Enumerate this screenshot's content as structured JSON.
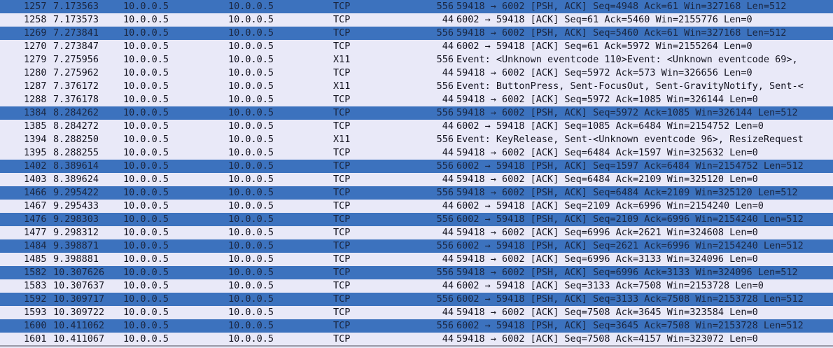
{
  "packets": [
    {
      "no": "1257",
      "time": "7.173563",
      "src": "10.0.0.5",
      "dst": "10.0.0.5",
      "proto": "TCP",
      "len": "556",
      "info": "59418 → 6002 [PSH, ACK] Seq=4948 Ack=61 Win=327168 Len=512",
      "selected": true
    },
    {
      "no": "1258",
      "time": "7.173573",
      "src": "10.0.0.5",
      "dst": "10.0.0.5",
      "proto": "TCP",
      "len": "44",
      "info": "6002 → 59418 [ACK] Seq=61 Ack=5460 Win=2155776 Len=0",
      "selected": false
    },
    {
      "no": "1269",
      "time": "7.273841",
      "src": "10.0.0.5",
      "dst": "10.0.0.5",
      "proto": "TCP",
      "len": "556",
      "info": "59418 → 6002 [PSH, ACK] Seq=5460 Ack=61 Win=327168 Len=512",
      "selected": true
    },
    {
      "no": "1270",
      "time": "7.273847",
      "src": "10.0.0.5",
      "dst": "10.0.0.5",
      "proto": "TCP",
      "len": "44",
      "info": "6002 → 59418 [ACK] Seq=61 Ack=5972 Win=2155264 Len=0",
      "selected": false
    },
    {
      "no": "1279",
      "time": "7.275956",
      "src": "10.0.0.5",
      "dst": "10.0.0.5",
      "proto": "X11",
      "len": "556",
      "info": "Event: <Unknown eventcode 110>Event: <Unknown eventcode 69>, ",
      "selected": false
    },
    {
      "no": "1280",
      "time": "7.275962",
      "src": "10.0.0.5",
      "dst": "10.0.0.5",
      "proto": "TCP",
      "len": "44",
      "info": "59418 → 6002 [ACK] Seq=5972 Ack=573 Win=326656 Len=0",
      "selected": false
    },
    {
      "no": "1287",
      "time": "7.376172",
      "src": "10.0.0.5",
      "dst": "10.0.0.5",
      "proto": "X11",
      "len": "556",
      "info": "Event: ButtonPress, Sent-FocusOut, Sent-GravityNotify, Sent-<",
      "selected": false
    },
    {
      "no": "1288",
      "time": "7.376178",
      "src": "10.0.0.5",
      "dst": "10.0.0.5",
      "proto": "TCP",
      "len": "44",
      "info": "59418 → 6002 [ACK] Seq=5972 Ack=1085 Win=326144 Len=0",
      "selected": false
    },
    {
      "no": "1384",
      "time": "8.284262",
      "src": "10.0.0.5",
      "dst": "10.0.0.5",
      "proto": "TCP",
      "len": "556",
      "info": "59418 → 6002 [PSH, ACK] Seq=5972 Ack=1085 Win=326144 Len=512",
      "selected": true
    },
    {
      "no": "1385",
      "time": "8.284272",
      "src": "10.0.0.5",
      "dst": "10.0.0.5",
      "proto": "TCP",
      "len": "44",
      "info": "6002 → 59418 [ACK] Seq=1085 Ack=6484 Win=2154752 Len=0",
      "selected": false
    },
    {
      "no": "1394",
      "time": "8.288250",
      "src": "10.0.0.5",
      "dst": "10.0.0.5",
      "proto": "X11",
      "len": "556",
      "info": "Event: KeyRelease, Sent-<Unknown eventcode 96>, ResizeRequest",
      "selected": false
    },
    {
      "no": "1395",
      "time": "8.288255",
      "src": "10.0.0.5",
      "dst": "10.0.0.5",
      "proto": "TCP",
      "len": "44",
      "info": "59418 → 6002 [ACK] Seq=6484 Ack=1597 Win=325632 Len=0",
      "selected": false
    },
    {
      "no": "1402",
      "time": "8.389614",
      "src": "10.0.0.5",
      "dst": "10.0.0.5",
      "proto": "TCP",
      "len": "556",
      "info": "6002 → 59418 [PSH, ACK] Seq=1597 Ack=6484 Win=2154752 Len=512",
      "selected": true
    },
    {
      "no": "1403",
      "time": "8.389624",
      "src": "10.0.0.5",
      "dst": "10.0.0.5",
      "proto": "TCP",
      "len": "44",
      "info": "59418 → 6002 [ACK] Seq=6484 Ack=2109 Win=325120 Len=0",
      "selected": false
    },
    {
      "no": "1466",
      "time": "9.295422",
      "src": "10.0.0.5",
      "dst": "10.0.0.5",
      "proto": "TCP",
      "len": "556",
      "info": "59418 → 6002 [PSH, ACK] Seq=6484 Ack=2109 Win=325120 Len=512",
      "selected": true
    },
    {
      "no": "1467",
      "time": "9.295433",
      "src": "10.0.0.5",
      "dst": "10.0.0.5",
      "proto": "TCP",
      "len": "44",
      "info": "6002 → 59418 [ACK] Seq=2109 Ack=6996 Win=2154240 Len=0",
      "selected": false
    },
    {
      "no": "1476",
      "time": "9.298303",
      "src": "10.0.0.5",
      "dst": "10.0.0.5",
      "proto": "TCP",
      "len": "556",
      "info": "6002 → 59418 [PSH, ACK] Seq=2109 Ack=6996 Win=2154240 Len=512",
      "selected": true
    },
    {
      "no": "1477",
      "time": "9.298312",
      "src": "10.0.0.5",
      "dst": "10.0.0.5",
      "proto": "TCP",
      "len": "44",
      "info": "59418 → 6002 [ACK] Seq=6996 Ack=2621 Win=324608 Len=0",
      "selected": false
    },
    {
      "no": "1484",
      "time": "9.398871",
      "src": "10.0.0.5",
      "dst": "10.0.0.5",
      "proto": "TCP",
      "len": "556",
      "info": "6002 → 59418 [PSH, ACK] Seq=2621 Ack=6996 Win=2154240 Len=512",
      "selected": true
    },
    {
      "no": "1485",
      "time": "9.398881",
      "src": "10.0.0.5",
      "dst": "10.0.0.5",
      "proto": "TCP",
      "len": "44",
      "info": "59418 → 6002 [ACK] Seq=6996 Ack=3133 Win=324096 Len=0",
      "selected": false
    },
    {
      "no": "1582",
      "time": "10.307626",
      "src": "10.0.0.5",
      "dst": "10.0.0.5",
      "proto": "TCP",
      "len": "556",
      "info": "59418 → 6002 [PSH, ACK] Seq=6996 Ack=3133 Win=324096 Len=512",
      "selected": true
    },
    {
      "no": "1583",
      "time": "10.307637",
      "src": "10.0.0.5",
      "dst": "10.0.0.5",
      "proto": "TCP",
      "len": "44",
      "info": "6002 → 59418 [ACK] Seq=3133 Ack=7508 Win=2153728 Len=0",
      "selected": false
    },
    {
      "no": "1592",
      "time": "10.309717",
      "src": "10.0.0.5",
      "dst": "10.0.0.5",
      "proto": "TCP",
      "len": "556",
      "info": "6002 → 59418 [PSH, ACK] Seq=3133 Ack=7508 Win=2153728 Len=512",
      "selected": true
    },
    {
      "no": "1593",
      "time": "10.309722",
      "src": "10.0.0.5",
      "dst": "10.0.0.5",
      "proto": "TCP",
      "len": "44",
      "info": "59418 → 6002 [ACK] Seq=7508 Ack=3645 Win=323584 Len=0",
      "selected": false
    },
    {
      "no": "1600",
      "time": "10.411062",
      "src": "10.0.0.5",
      "dst": "10.0.0.5",
      "proto": "TCP",
      "len": "556",
      "info": "6002 → 59418 [PSH, ACK] Seq=3645 Ack=7508 Win=2153728 Len=512",
      "selected": true
    },
    {
      "no": "1601",
      "time": "10.411067",
      "src": "10.0.0.5",
      "dst": "10.0.0.5",
      "proto": "TCP",
      "len": "44",
      "info": "59418 → 6002 [ACK] Seq=7508 Ack=4157 Win=323072 Len=0",
      "selected": false
    }
  ],
  "colors": {
    "row_background": "#e9e9f8",
    "selected_background": "#3c72be"
  }
}
